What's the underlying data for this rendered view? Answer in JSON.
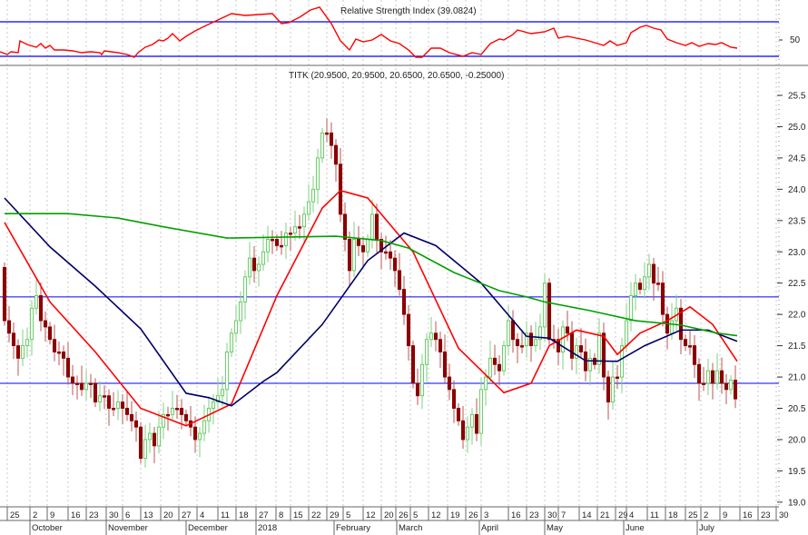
{
  "chart_data": {
    "type": "candlestick",
    "symbol_label": "TITK (20.9500, 20.9500, 20.6500, 20.6500, -0.25000)",
    "rsi_label": "Relative Strength Index (39.0824)",
    "rsi_tick_label": "50",
    "ylim": [
      19.0,
      25.5
    ],
    "y_ticks": [
      "25.5",
      "25.0",
      "24.5",
      "24.0",
      "23.5",
      "23.0",
      "22.5",
      "22.0",
      "21.5",
      "21.0",
      "20.5",
      "20.0",
      "19.5",
      "19.0"
    ],
    "horizontal_levels": [
      22.28,
      20.9
    ],
    "rsi_levels": [
      70,
      30
    ],
    "note": "open of each candle equals previous close",
    "first_open": 22.75,
    "close": [
      21.9,
      21.7,
      21.5,
      21.3,
      21.5,
      21.6,
      22.1,
      22.3,
      21.9,
      21.8,
      21.6,
      21.4,
      21.4,
      21.3,
      21.0,
      20.9,
      20.9,
      20.8,
      20.9,
      20.9,
      20.6,
      20.7,
      20.7,
      20.5,
      20.5,
      20.6,
      20.5,
      20.4,
      20.3,
      20.2,
      19.7,
      20.0,
      20.1,
      19.9,
      20.2,
      20.4,
      20.4,
      20.5,
      20.5,
      20.4,
      20.3,
      20.2,
      20.0,
      20.1,
      20.3,
      20.5,
      20.6,
      20.7,
      20.8,
      21.4,
      21.7,
      21.9,
      22.2,
      22.6,
      22.9,
      22.7,
      22.8,
      23.0,
      23.2,
      23.2,
      23.1,
      23.1,
      23.3,
      23.3,
      23.4,
      23.4,
      23.6,
      23.8,
      24.0,
      24.5,
      24.9,
      24.9,
      24.7,
      24.4,
      23.6,
      23.2,
      22.7,
      23.2,
      23.1,
      23.0,
      23.2,
      23.6,
      23.2,
      23.0,
      23.0,
      22.9,
      22.7,
      22.4,
      22.0,
      21.5,
      20.9,
      20.7,
      21.2,
      21.6,
      21.7,
      21.6,
      21.4,
      21.0,
      20.8,
      20.5,
      20.3,
      20.0,
      20.2,
      20.4,
      20.1,
      20.8,
      21.0,
      21.3,
      21.2,
      21.1,
      21.5,
      21.9,
      21.6,
      21.5,
      21.5,
      21.7,
      21.5,
      21.6,
      21.8,
      22.5,
      21.6,
      21.6,
      21.4,
      21.8,
      21.7,
      21.3,
      21.5,
      21.4,
      21.1,
      21.3,
      21.2,
      21.7,
      21.0,
      20.6,
      21.0,
      21.0,
      21.5,
      21.9,
      22.3,
      22.5,
      22.4,
      22.6,
      22.8,
      22.5,
      22.5,
      22.0,
      21.7,
      21.9,
      22.1,
      21.6,
      21.5,
      21.5,
      21.2,
      20.9,
      20.9,
      21.1,
      20.9,
      21.1,
      20.9,
      20.8,
      20.95,
      20.65
    ],
    "ma_series": [
      {
        "name": "MA short",
        "color": "#ff0000",
        "points": [
          [
            0,
            23.47
          ],
          [
            10,
            22.2
          ],
          [
            20,
            21.4
          ],
          [
            30,
            20.5
          ],
          [
            40,
            20.22
          ],
          [
            50,
            20.57
          ],
          [
            60,
            22.3
          ],
          [
            70,
            23.7
          ],
          [
            74,
            23.98
          ],
          [
            80,
            23.86
          ],
          [
            90,
            23.0
          ],
          [
            100,
            21.46
          ],
          [
            110,
            20.75
          ],
          [
            116,
            20.9
          ],
          [
            120,
            21.5
          ],
          [
            126,
            21.75
          ],
          [
            132,
            21.65
          ],
          [
            135,
            21.36
          ],
          [
            140,
            21.7
          ],
          [
            146,
            21.9
          ],
          [
            151,
            22.12
          ],
          [
            156,
            21.84
          ],
          [
            161.4,
            21.25
          ]
        ]
      },
      {
        "name": "MA medium",
        "color": "#000066",
        "points": [
          [
            0,
            23.86
          ],
          [
            10,
            23.08
          ],
          [
            20,
            22.45
          ],
          [
            30,
            21.77
          ],
          [
            40,
            20.74
          ],
          [
            45,
            20.67
          ],
          [
            50,
            20.54
          ],
          [
            57,
            20.93
          ],
          [
            60,
            21.07
          ],
          [
            70,
            21.84
          ],
          [
            80,
            22.86
          ],
          [
            88,
            23.3
          ],
          [
            95,
            23.1
          ],
          [
            105,
            22.5
          ],
          [
            115,
            21.65
          ],
          [
            120,
            21.62
          ],
          [
            128,
            21.26
          ],
          [
            135,
            21.25
          ],
          [
            141,
            21.5
          ],
          [
            149,
            21.75
          ],
          [
            155,
            21.75
          ],
          [
            161.4,
            21.57
          ]
        ]
      },
      {
        "name": "MA long",
        "color": "#00a000",
        "points": [
          [
            0,
            23.61
          ],
          [
            14,
            23.61
          ],
          [
            25,
            23.54
          ],
          [
            35,
            23.4
          ],
          [
            49,
            23.22
          ],
          [
            57,
            23.23
          ],
          [
            73,
            23.25
          ],
          [
            83,
            23.18
          ],
          [
            89,
            23.06
          ],
          [
            99,
            22.67
          ],
          [
            109,
            22.38
          ],
          [
            115,
            22.28
          ],
          [
            119,
            22.2
          ],
          [
            129,
            22.06
          ],
          [
            139,
            21.9
          ],
          [
            149,
            21.83
          ],
          [
            157,
            21.7
          ],
          [
            161.4,
            21.66
          ]
        ]
      }
    ],
    "rsi": [
      [
        -1,
        35
      ],
      [
        0.6,
        32
      ],
      [
        1.4,
        35
      ],
      [
        3,
        34
      ],
      [
        3.4,
        47
      ],
      [
        5,
        43
      ],
      [
        7,
        40
      ],
      [
        8,
        44
      ],
      [
        9,
        39
      ],
      [
        10,
        42
      ],
      [
        11,
        37
      ],
      [
        13,
        37
      ],
      [
        15,
        36
      ],
      [
        17,
        34
      ],
      [
        19,
        35
      ],
      [
        21,
        34
      ],
      [
        21.4,
        32
      ],
      [
        22,
        36
      ],
      [
        25,
        34
      ],
      [
        27,
        32
      ],
      [
        28.6,
        29
      ],
      [
        29.4,
        34
      ],
      [
        31,
        40
      ],
      [
        32.6,
        43
      ],
      [
        34,
        48
      ],
      [
        35,
        47
      ],
      [
        36,
        50
      ],
      [
        37,
        55
      ],
      [
        38.6,
        47
      ],
      [
        40,
        52
      ],
      [
        42,
        58
      ],
      [
        44,
        63
      ],
      [
        47,
        70
      ],
      [
        50,
        77
      ],
      [
        53,
        75
      ],
      [
        56,
        76
      ],
      [
        59,
        77
      ],
      [
        61,
        66
      ],
      [
        62.6,
        67
      ],
      [
        65,
        73
      ],
      [
        67.4,
        81
      ],
      [
        69.4,
        84
      ],
      [
        72,
        66
      ],
      [
        74,
        47
      ],
      [
        76,
        37
      ],
      [
        77.4,
        49
      ],
      [
        79,
        46
      ],
      [
        81,
        48
      ],
      [
        83,
        54
      ],
      [
        85,
        47
      ],
      [
        87,
        44
      ],
      [
        89,
        37
      ],
      [
        90.6,
        29
      ],
      [
        92,
        29
      ],
      [
        94,
        39
      ],
      [
        96,
        39
      ],
      [
        98,
        34
      ],
      [
        101,
        30
      ],
      [
        103,
        34
      ],
      [
        105,
        32
      ],
      [
        107,
        44
      ],
      [
        109,
        49
      ],
      [
        110,
        48
      ],
      [
        112,
        54
      ],
      [
        113,
        59
      ],
      [
        116,
        55
      ],
      [
        119,
        57
      ],
      [
        121,
        61
      ],
      [
        122,
        50
      ],
      [
        124,
        52
      ],
      [
        126,
        50
      ],
      [
        128,
        48
      ],
      [
        130,
        45
      ],
      [
        132,
        42
      ],
      [
        133.4,
        47
      ],
      [
        135,
        42
      ],
      [
        137,
        45
      ],
      [
        138,
        56
      ],
      [
        140,
        62
      ],
      [
        141.4,
        64
      ],
      [
        143,
        61
      ],
      [
        144.6,
        59
      ],
      [
        146,
        49
      ],
      [
        148,
        45
      ],
      [
        150,
        42
      ],
      [
        151.4,
        45
      ],
      [
        153,
        41
      ],
      [
        155,
        44
      ],
      [
        156.6,
        43
      ],
      [
        158,
        45
      ],
      [
        160,
        40
      ],
      [
        161.4,
        39
      ]
    ],
    "date_ticks": [
      {
        "label": "25",
        "i": 0.6
      },
      {
        "label": "2",
        "i": 5.6
      },
      {
        "label": "9",
        "i": 9.4
      },
      {
        "label": "16",
        "i": 14
      },
      {
        "label": "23",
        "i": 18
      },
      {
        "label": "30",
        "i": 22.4
      },
      {
        "label": "6",
        "i": 26
      },
      {
        "label": "13",
        "i": 30
      },
      {
        "label": "20",
        "i": 34.4
      },
      {
        "label": "27",
        "i": 38.4
      },
      {
        "label": "4",
        "i": 42.4
      },
      {
        "label": "11",
        "i": 47
      },
      {
        "label": "18",
        "i": 51
      },
      {
        "label": "27",
        "i": 55.4
      },
      {
        "label": "8",
        "i": 59.8
      },
      {
        "label": "15",
        "i": 63
      },
      {
        "label": "22",
        "i": 67
      },
      {
        "label": "29",
        "i": 71
      },
      {
        "label": "5",
        "i": 74.6
      },
      {
        "label": "12",
        "i": 79
      },
      {
        "label": "20",
        "i": 83
      },
      {
        "label": "26",
        "i": 86.2
      },
      {
        "label": "5",
        "i": 89.4
      },
      {
        "label": "12",
        "i": 93.4
      },
      {
        "label": "19",
        "i": 97.6
      },
      {
        "label": "26",
        "i": 101.6
      },
      {
        "label": "3",
        "i": 105
      },
      {
        "label": "16",
        "i": 111
      },
      {
        "label": "23",
        "i": 115
      },
      {
        "label": "30",
        "i": 119
      },
      {
        "label": "7",
        "i": 122
      },
      {
        "label": "14",
        "i": 126.6
      },
      {
        "label": "21",
        "i": 130.6
      },
      {
        "label": "29",
        "i": 134.6
      },
      {
        "label": "4",
        "i": 137
      },
      {
        "label": "11",
        "i": 141.6
      },
      {
        "label": "18",
        "i": 145.6
      },
      {
        "label": "25",
        "i": 150
      },
      {
        "label": "2",
        "i": 153.4
      },
      {
        "label": "9",
        "i": 157.6
      },
      {
        "label": "16",
        "i": 162
      },
      {
        "label": "23",
        "i": 166
      },
      {
        "label": "30",
        "i": 170
      }
    ],
    "month_ticks": [
      {
        "label": "October",
        "i": 5.6
      },
      {
        "label": "November",
        "i": 22.4
      },
      {
        "label": "December",
        "i": 40
      },
      {
        "label": "2018",
        "i": 55.4
      },
      {
        "label": "February",
        "i": 72.6
      },
      {
        "label": "March",
        "i": 86.4
      },
      {
        "label": "April",
        "i": 104.6
      },
      {
        "label": "May",
        "i": 119
      },
      {
        "label": "June",
        "i": 136.4
      },
      {
        "label": "July",
        "i": 152.6
      }
    ],
    "colors": {
      "up": "#5ac85a",
      "down": "#8b0000",
      "level": "#0000ff",
      "rsi": "#ff0000"
    }
  }
}
